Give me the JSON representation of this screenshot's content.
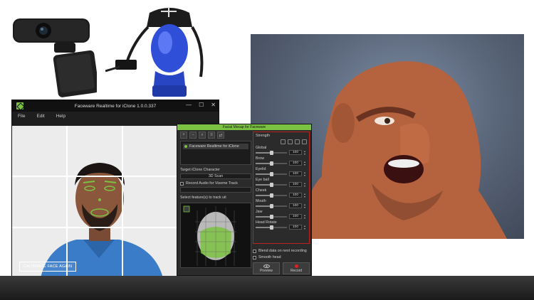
{
  "faceware": {
    "title": "Faceware Realtime for iClone 1.0.0.337",
    "window_controls": [
      "—",
      "☐",
      "✕"
    ],
    "menu": [
      "File",
      "Edit",
      "Help"
    ],
    "calibrate_label": "CALIBRATE FACE AGAIN"
  },
  "iclone": {
    "title": "Facial Mocap for Faceware",
    "device_name": "Faceware Realtime for iClone",
    "target_label": "Target iClone Character",
    "target_value": "3D Scan",
    "record_audio_label": "Record Audio for Viseme Track",
    "feature_label": "Select feature(s) to track uit",
    "strength_label": "Strength",
    "sliders": [
      {
        "label": "Global",
        "value": "100",
        "level": 0.5
      },
      {
        "label": "Brow",
        "value": "100",
        "level": 0.5
      },
      {
        "label": "Eyelid",
        "value": "100",
        "level": 0.5
      },
      {
        "label": "Eye ball",
        "value": "100",
        "level": 0.5
      },
      {
        "label": "Cheek",
        "value": "100",
        "level": 0.5
      },
      {
        "label": "Mouth",
        "value": "100",
        "level": 0.5
      },
      {
        "label": "Jaw",
        "value": "100",
        "level": 0.5
      },
      {
        "label": "Head Rotate",
        "value": "100",
        "level": 0.5
      }
    ],
    "blend_label": "Blend data on next recording",
    "smooth_label": "Smooth head",
    "preview_label": "Preview",
    "record_label": "Record"
  },
  "colors": {
    "accent_green": "#7cc242",
    "record_red": "#e02020",
    "slider_border": "#b22222"
  },
  "icons": {
    "logo": "faceware-logo-icon",
    "preview": "eye-icon",
    "record": "record-icon"
  }
}
